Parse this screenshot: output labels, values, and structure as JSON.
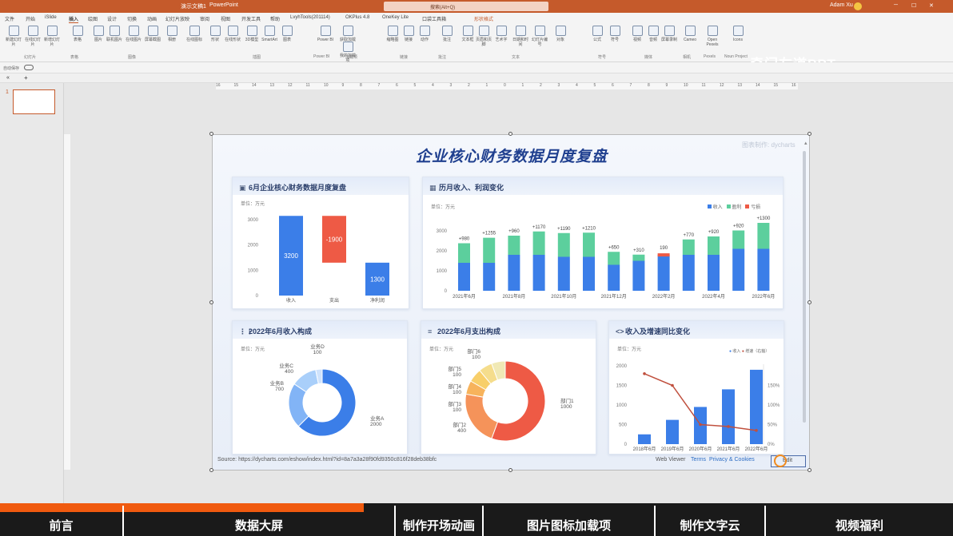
{
  "window": {
    "title": "演示文稿1",
    "app": "PowerPoint",
    "user": "Adam Xu",
    "search": "搜索(Alt+Q)"
  },
  "menu": [
    "文件",
    "开始",
    "iSlide",
    "插入",
    "绘图",
    "设计",
    "切换",
    "动画",
    "幻灯片放映",
    "审阅",
    "视图",
    "开发工具",
    "帮助",
    "LvyhTools(201114)",
    "OKPlus 4.8",
    "OneKey Lite",
    "口袋工具箱",
    "形状格式"
  ],
  "ribbon": {
    "buttons": [
      "新建幻灯片",
      "在线幻灯片",
      "新增幻灯片",
      "表格",
      "图片",
      "联机图片",
      "在线图片",
      "屏幕截图",
      "相册",
      "在线图标",
      "形状",
      "在线形状",
      "3D模型",
      "SmartArt",
      "图表",
      "Power BI",
      "获取加载项",
      "我的加载项",
      "缩略图",
      "链接",
      "动作",
      "批注",
      "文本框",
      "页眉和页脚",
      "艺术字",
      "日期和时间",
      "幻灯片编号",
      "对象",
      "公式",
      "符号",
      "视频",
      "音频",
      "屏幕录制",
      "Cameo",
      "Open Pexels",
      "Icons"
    ],
    "groups": [
      "幻灯片",
      "表格",
      "图像",
      "插图",
      "Power BI",
      "加载项",
      "链接",
      "批注",
      "文本",
      "符号",
      "媒体",
      "相机",
      "Pexels",
      "Noun Project"
    ],
    "watermark": "奇门左道PPT"
  },
  "qat": {
    "autosave": "自动保存"
  },
  "slide_number": "1",
  "slide": {
    "title": "企业核心财务数据月度复盘",
    "brand": "图表制作: dycharts",
    "footer": {
      "source": "Source: https://dycharts.com/eshow/index.html?id=8a7a3a28f90fd9350c816f28deb38bfc",
      "web": "Web Viewer",
      "terms": "Terms",
      "privacy": "Privacy & Cookies",
      "edit": "Edit"
    },
    "panels": {
      "p1": {
        "title": "6月企业核心财务数据月度复盘",
        "unit": "单位：万元"
      },
      "p2": {
        "title": "历月收入、利润变化",
        "unit": "单位：万元",
        "legend": [
          "收入",
          "盈利",
          "亏损"
        ]
      },
      "p3": {
        "title": "2022年6月收入构成",
        "unit": "单位：万元"
      },
      "p4": {
        "title": "2022年6月支出构成",
        "unit": "单位：万元"
      },
      "p5": {
        "title": "收入及增速同比变化",
        "unit": "单位：万元",
        "legend": [
          "收入",
          "增速（右轴）"
        ]
      }
    }
  },
  "colors": {
    "blue": "#3b7ee8",
    "green": "#5ccf9d",
    "red": "#ee5a45",
    "line": "#c0503e"
  },
  "chart_data": [
    {
      "type": "bar",
      "title": "6月企业核心财务数据月度复盘",
      "categories": [
        "收入",
        "支出",
        "净利润"
      ],
      "values": [
        3200,
        -1900,
        1300
      ],
      "ylim": [
        0,
        3000
      ],
      "yticks": [
        0,
        1000,
        2000,
        3000
      ]
    },
    {
      "type": "bar",
      "title": "历月收入、利润变化",
      "categories": [
        "2021年6月",
        "2021年7月",
        "2021年8月",
        "2021年9月",
        "2021年10月",
        "2021年11月",
        "2021年12月",
        "2022年1月",
        "2022年2月",
        "2022年3月",
        "2022年4月",
        "2022年5月",
        "2022年6月"
      ],
      "xticks": [
        "2021年6月",
        "2021年8月",
        "2021年10月",
        "2021年12月",
        "2022年2月",
        "2022年4月",
        "2022年6月"
      ],
      "series": [
        {
          "name": "收入",
          "values": [
            1400,
            1400,
            1800,
            1800,
            1700,
            1700,
            1300,
            1500,
            1800,
            1800,
            1800,
            2100,
            2100
          ]
        },
        {
          "name": "盈利",
          "values": [
            980,
            1255,
            960,
            1170,
            1190,
            1210,
            650,
            310,
            0,
            770,
            920,
            920,
            1300
          ]
        },
        {
          "name": "亏损",
          "values": [
            0,
            0,
            0,
            0,
            0,
            0,
            0,
            0,
            190,
            0,
            0,
            0,
            0
          ]
        }
      ],
      "labels": [
        "+980",
        "+1255",
        "+960",
        "+1170",
        "+1190",
        "+1210",
        "+650",
        "+310",
        "190",
        "+770",
        "+920",
        "+920",
        "+1300"
      ],
      "ylim": [
        0,
        3000
      ],
      "yticks": [
        0,
        1000,
        2000,
        3000
      ]
    },
    {
      "type": "pie",
      "title": "2022年6月收入构成",
      "labels": [
        "业务A",
        "业务B",
        "业务C",
        "业务D"
      ],
      "values": [
        2000,
        700,
        400,
        100
      ],
      "colors": [
        "#3b7ee8",
        "#82b4f6",
        "#a9cffa",
        "#cfe3fc"
      ]
    },
    {
      "type": "pie",
      "title": "2022年6月支出构成",
      "labels": [
        "部门1",
        "部门2",
        "部门3",
        "部门4",
        "部门5",
        "部门6"
      ],
      "values": [
        1000,
        400,
        100,
        100,
        100,
        100
      ],
      "colors": [
        "#ee5a45",
        "#f5935a",
        "#f7b35c",
        "#f8cf6a",
        "#f5dd8c",
        "#f0e9b5"
      ]
    },
    {
      "type": "bar",
      "title": "收入及增速同比变化",
      "categories": [
        "2018年6月",
        "2019年6月",
        "2020年6月",
        "2021年6月",
        "2022年6月"
      ],
      "series": [
        {
          "name": "收入",
          "values": [
            250,
            620,
            950,
            1400,
            1900
          ]
        },
        {
          "name": "增速（右轴）",
          "values": [
            180,
            150,
            50,
            45,
            35
          ]
        }
      ],
      "ylim": [
        0,
        2000
      ],
      "yticks": [
        0,
        500,
        1000,
        1500,
        2000
      ],
      "y2ticks": [
        "0%",
        "50%",
        "100%",
        "150%"
      ]
    }
  ],
  "bottom_nav": [
    "前言",
    "数据大屏",
    "制作开场动画",
    "图片图标加载项",
    "制作文字云",
    "视频福利"
  ]
}
